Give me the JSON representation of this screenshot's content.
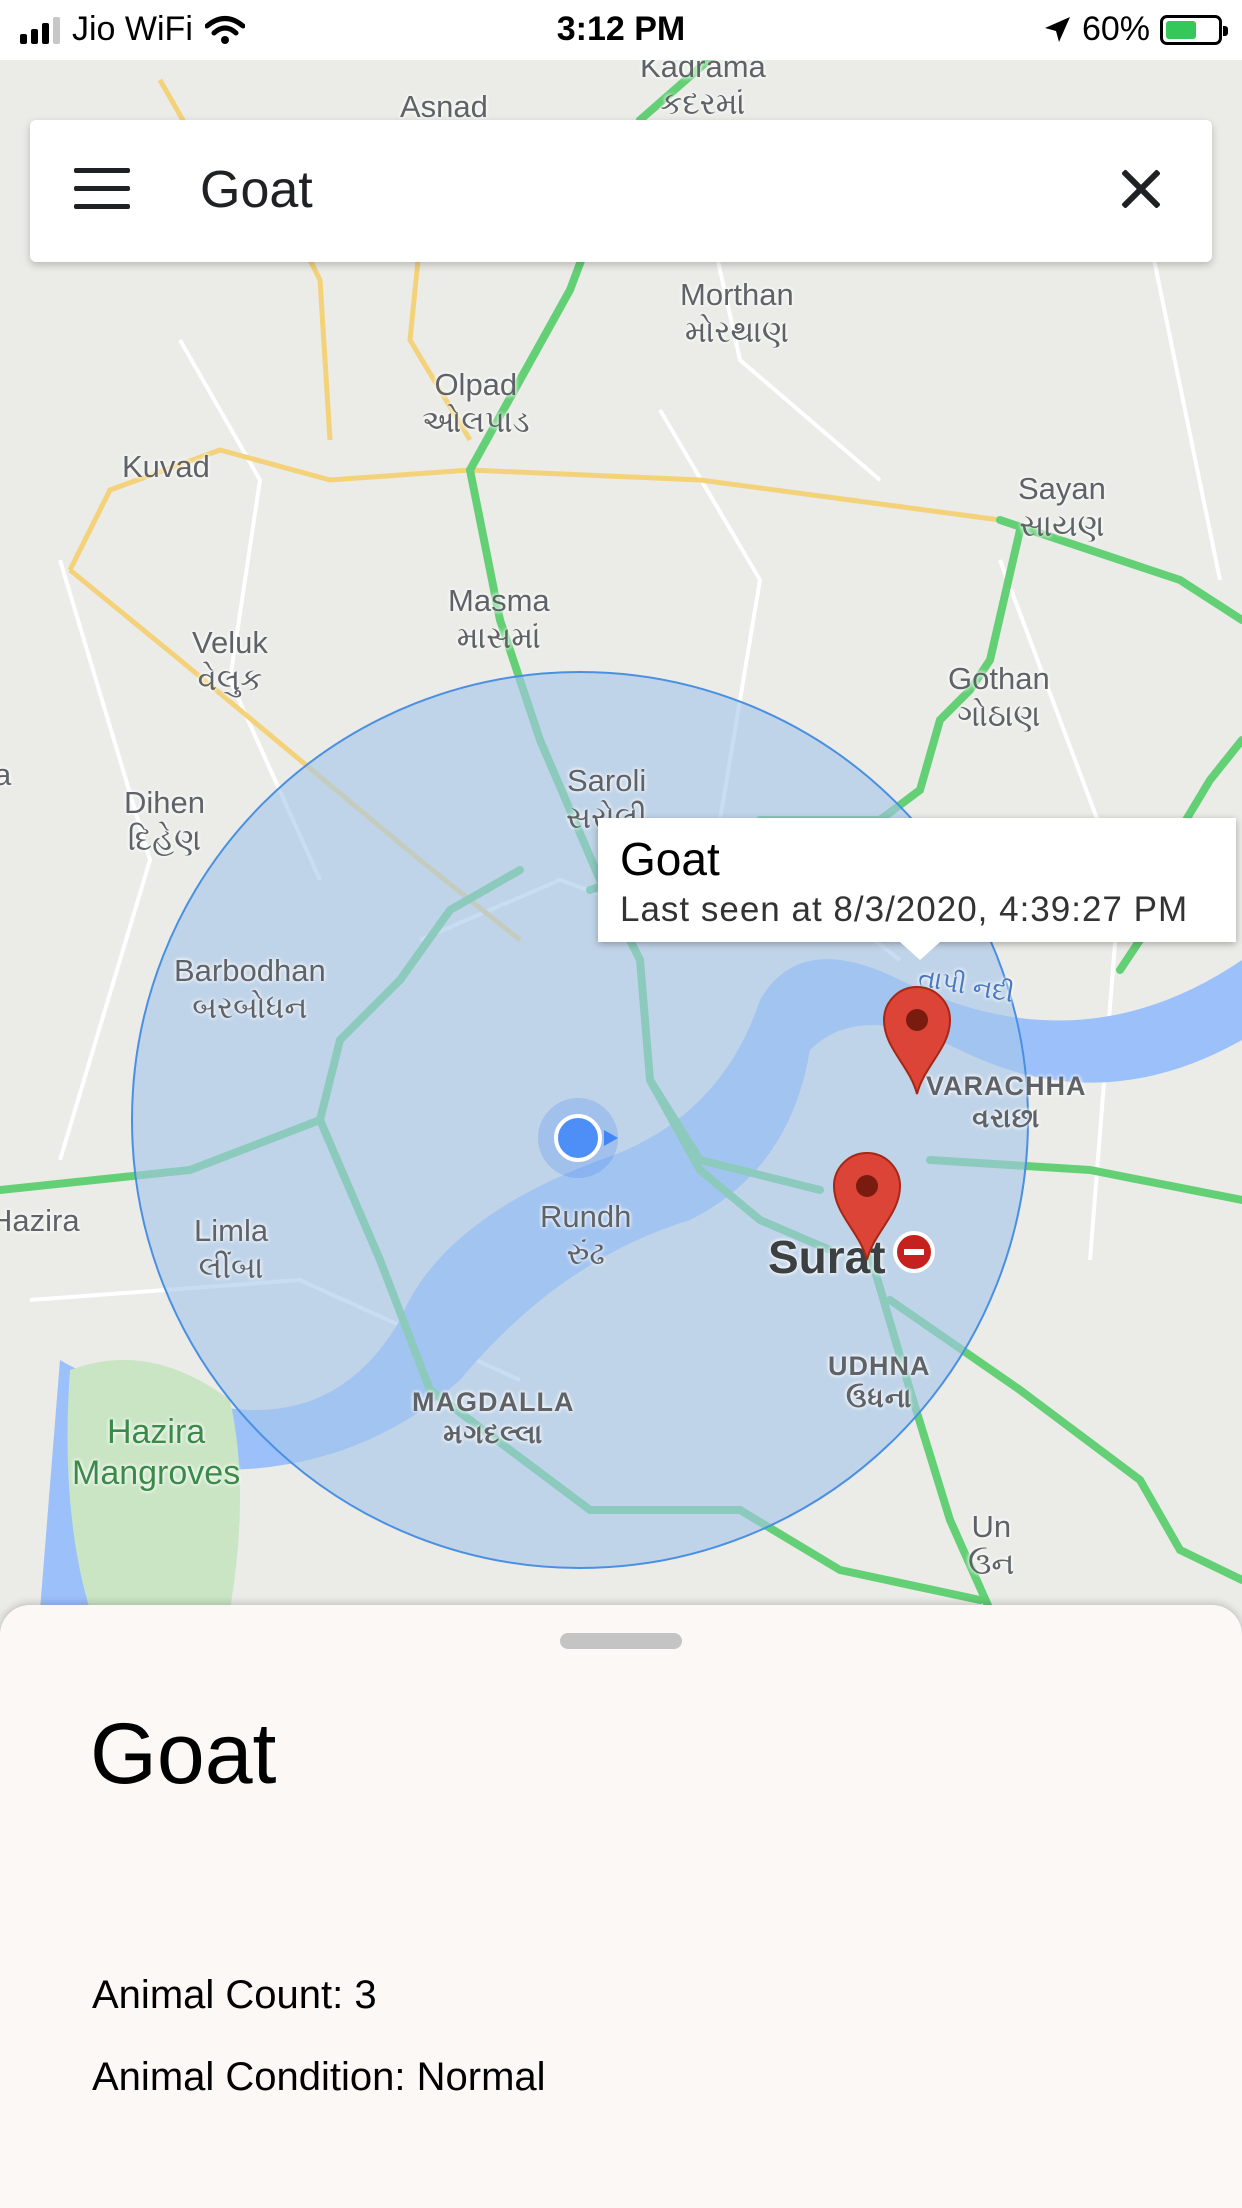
{
  "status_bar": {
    "carrier": "Jio WiFi",
    "time": "3:12 PM",
    "battery": "60%",
    "battery_level": 0.6,
    "icons": [
      "signal-icon",
      "wifi-icon",
      "location-arrow-icon",
      "battery-charging-icon"
    ]
  },
  "search": {
    "query": "Goat",
    "menu_icon": "menu-icon",
    "clear_icon": "close-icon"
  },
  "map": {
    "places": {
      "kadrama": "Kadrama\nકદરમાં",
      "asnad": "Asnad",
      "morthan": "Morthan\nમોરથાણ",
      "olpad": "Olpad\nઓલપાડ",
      "kuvad": "Kuvad",
      "sayan": "Sayan\nસાયણ",
      "masma": "Masma\nમાસમાં",
      "veluk": "Veluk\nવેલુક",
      "gothan": "Gothan\nગોઠાણ",
      "dihen": "Dihen\nદિહેણ",
      "saroli": "Saroli\nસરોલી",
      "barbodhan": "Barbodhan\nબરબોધન",
      "tapi": "તાપી નદી",
      "varachha": "VARACHHA\nવરાછા",
      "hazira": "Hazira",
      "limla": "Limla\nલીંબા",
      "rundh": "Rundh\nરુંઢ",
      "surat": "Surat",
      "udhna": "UDHNA\nઉધના",
      "magdalla": "MAGDALLA\nમગદલ્લા",
      "mangroves": "Hazira\nMangroves",
      "un": "Un\nઉન",
      "a": "a"
    },
    "colors": {
      "radius_fill": "#b3cff0",
      "radius_stroke": "#4a90e2",
      "marker": "#db4437",
      "user_location": "#4285f4",
      "traffic_green": "#63d075",
      "highway_yellow": "#f7d774"
    }
  },
  "infowindow": {
    "title": "Goat",
    "subtitle": "Last seen at 8/3/2020, 4:39:27 PM"
  },
  "sheet": {
    "title": "Goat",
    "animal_count": "Animal Count: 3",
    "animal_condition": "Animal Condition: Normal"
  }
}
